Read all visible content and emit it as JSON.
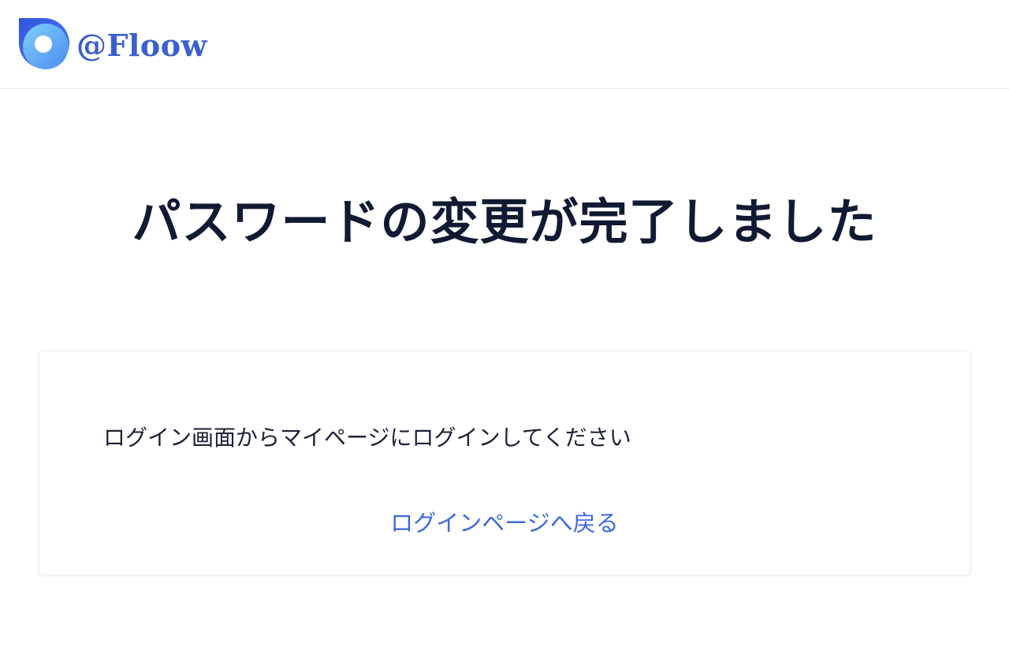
{
  "header": {
    "logo_text": "@Floow",
    "logo_icon": "floow-logo-icon",
    "brand_color": "#3a5fd0"
  },
  "main": {
    "title": "パスワードの変更が完了しました",
    "card": {
      "message": "ログイン画面からマイページにログインしてください",
      "back_link_label": "ログインページへ戻る",
      "link_color": "#3e68dc"
    }
  }
}
